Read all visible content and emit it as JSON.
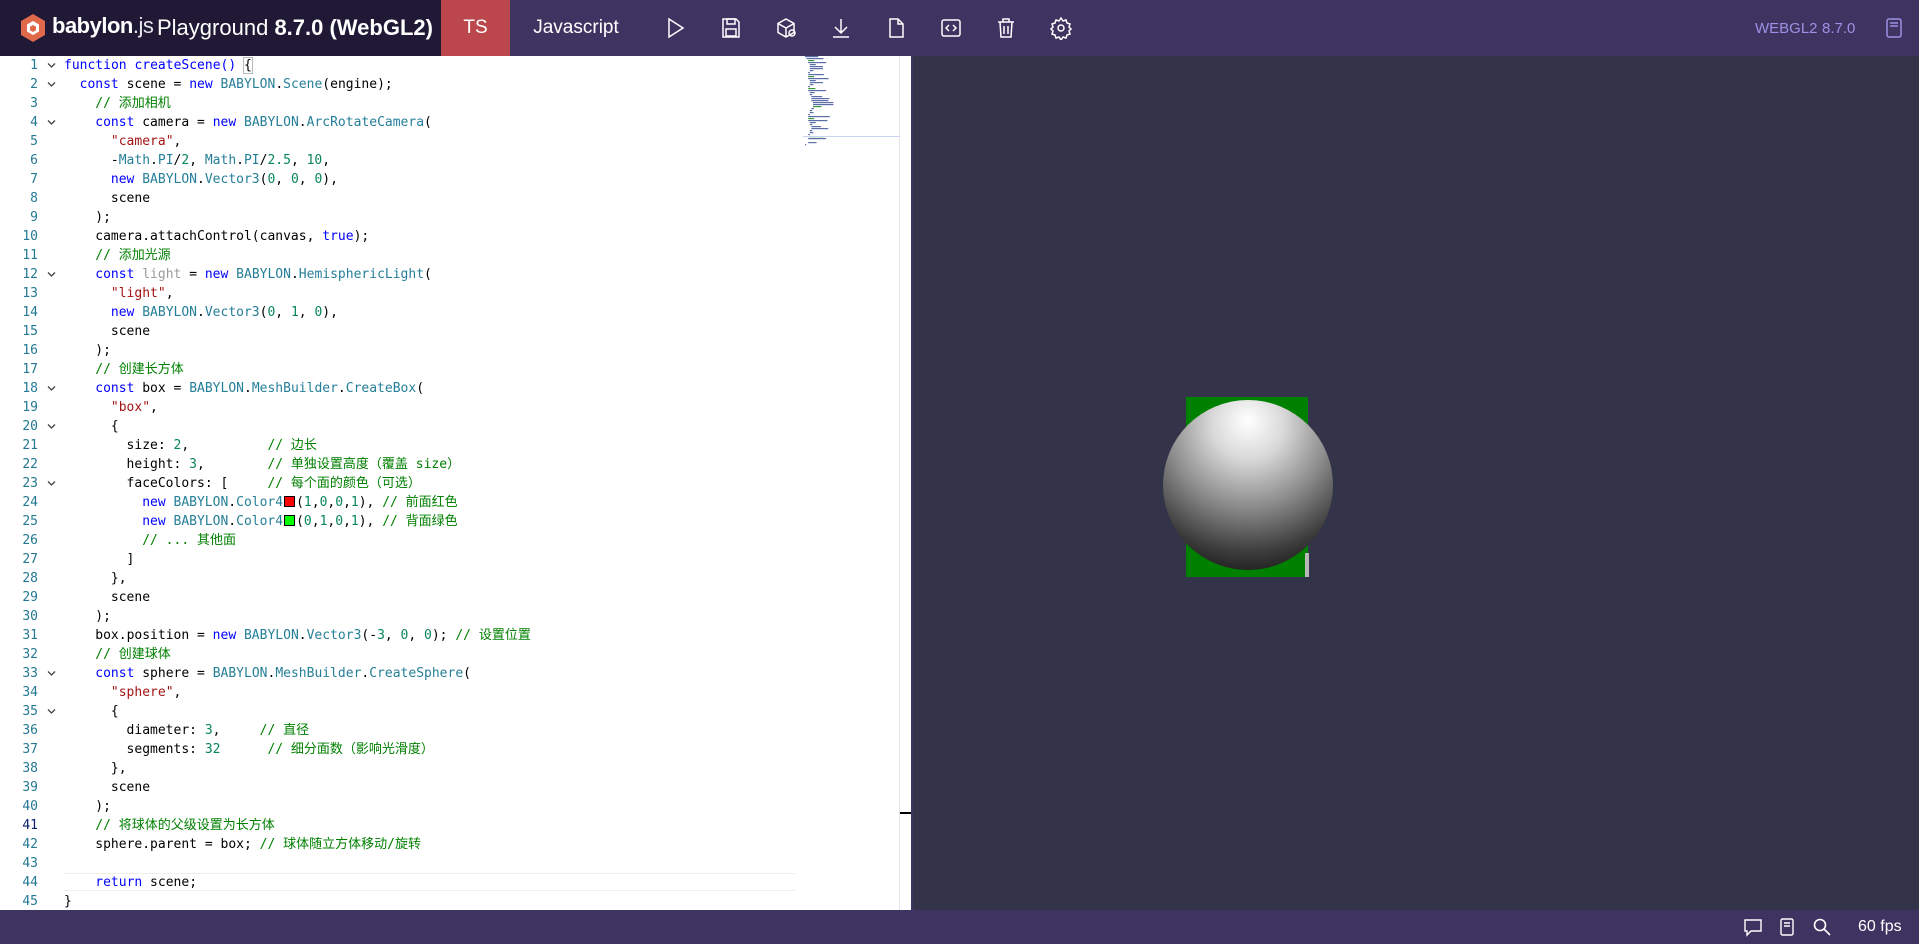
{
  "header": {
    "brand_name": "babylon",
    "brand_ext": ".js",
    "playground_label": "Playground",
    "version_label": "8.7.0 (WebGL2)",
    "lang_ts": "TS",
    "lang_js": "Javascript",
    "toolbar_icons": [
      "run-icon",
      "save-icon",
      "inspector-icon",
      "download-icon",
      "new-icon",
      "clear-icon",
      "delete-icon",
      "settings-icon"
    ],
    "engine_label": "WEBGL2",
    "engine_version": "8.7.0",
    "colors": {
      "header_bg": "#3f3461",
      "brand_bg": "#201936",
      "active_lang": "#bb464b",
      "accent_text": "#9c91e6"
    }
  },
  "editor": {
    "active_line": 41,
    "lines": [
      {
        "n": "1",
        "fold": true
      },
      {
        "n": "2",
        "fold": true
      },
      {
        "n": "3",
        "fold": false
      },
      {
        "n": "4",
        "fold": true
      },
      {
        "n": "5",
        "fold": false
      },
      {
        "n": "6",
        "fold": false
      },
      {
        "n": "7",
        "fold": false
      },
      {
        "n": "8",
        "fold": false
      },
      {
        "n": "9",
        "fold": false
      },
      {
        "n": "10",
        "fold": false
      },
      {
        "n": "11",
        "fold": false
      },
      {
        "n": "12",
        "fold": true
      },
      {
        "n": "13",
        "fold": false
      },
      {
        "n": "14",
        "fold": false
      },
      {
        "n": "15",
        "fold": false
      },
      {
        "n": "16",
        "fold": false
      },
      {
        "n": "17",
        "fold": false
      },
      {
        "n": "18",
        "fold": true
      },
      {
        "n": "19",
        "fold": false
      },
      {
        "n": "20",
        "fold": true
      },
      {
        "n": "21",
        "fold": false
      },
      {
        "n": "22",
        "fold": false
      },
      {
        "n": "23",
        "fold": true
      },
      {
        "n": "24",
        "fold": false
      },
      {
        "n": "25",
        "fold": false
      },
      {
        "n": "26",
        "fold": false
      },
      {
        "n": "27",
        "fold": false
      },
      {
        "n": "28",
        "fold": false
      },
      {
        "n": "29",
        "fold": false
      },
      {
        "n": "30",
        "fold": false
      },
      {
        "n": "31",
        "fold": false
      },
      {
        "n": "32",
        "fold": false
      },
      {
        "n": "33",
        "fold": true
      },
      {
        "n": "34",
        "fold": false
      },
      {
        "n": "35",
        "fold": true
      },
      {
        "n": "36",
        "fold": false
      },
      {
        "n": "37",
        "fold": false
      },
      {
        "n": "38",
        "fold": false
      },
      {
        "n": "39",
        "fold": false
      },
      {
        "n": "40",
        "fold": false
      },
      {
        "n": "41",
        "fold": false
      },
      {
        "n": "42",
        "fold": false
      },
      {
        "n": "43",
        "fold": false
      },
      {
        "n": "44",
        "fold": false
      },
      {
        "n": "45",
        "fold": false
      }
    ],
    "code": {
      "l1": [
        "function createScene() ",
        "{"
      ],
      "l2": [
        "const",
        " scene = ",
        "new",
        " ",
        "BABYLON",
        ".",
        "Scene",
        "(engine);"
      ],
      "l3": "// 添加相机",
      "l4": [
        "const",
        " camera = ",
        "new",
        " ",
        "BABYLON",
        ".",
        "ArcRotateCamera",
        "("
      ],
      "l5": [
        "\"camera\"",
        ","
      ],
      "l6": [
        "-",
        "Math",
        ".",
        "PI",
        "/",
        "2",
        ", ",
        "Math",
        ".",
        "PI",
        "/",
        "2.5",
        ", ",
        "10",
        ","
      ],
      "l7": [
        "new",
        " ",
        "BABYLON",
        ".",
        "Vector3",
        "(",
        "0",
        ", ",
        "0",
        ", ",
        "0",
        "),"
      ],
      "l8": "scene",
      "l9": ");",
      "l10": [
        "camera.attachControl(canvas, ",
        "true",
        ");"
      ],
      "l11": "// 添加光源",
      "l12": [
        "const",
        " ",
        "light",
        " = ",
        "new",
        " ",
        "BABYLON",
        ".",
        "HemisphericLight",
        "("
      ],
      "l13": [
        "\"light\"",
        ","
      ],
      "l14": [
        "new",
        " ",
        "BABYLON",
        ".",
        "Vector3",
        "(",
        "0",
        ", ",
        "1",
        ", ",
        "0",
        "),"
      ],
      "l15": "scene",
      "l16": ");",
      "l17": "// 创建长方体",
      "l18": [
        "const",
        " box = ",
        "BABYLON",
        ".",
        "MeshBuilder",
        ".",
        "CreateBox",
        "("
      ],
      "l19": [
        "\"box\"",
        ","
      ],
      "l20": "{",
      "l21": [
        "size: ",
        "2",
        ",          ",
        "// 边长"
      ],
      "l22": [
        "height: ",
        "3",
        ",        ",
        "// 单独设置高度（覆盖 size）"
      ],
      "l23": [
        "faceColors: [     ",
        "// 每个面的颜色（可选）"
      ],
      "l24": [
        "new",
        " ",
        "BABYLON",
        ".",
        "Color4",
        "(",
        "1",
        ",",
        "0",
        ",",
        "0",
        ",",
        "1",
        "), ",
        "// 前面红色"
      ],
      "l25": [
        "new",
        " ",
        "BABYLON",
        ".",
        "Color4",
        "(",
        "0",
        ",",
        "1",
        ",",
        "0",
        ",",
        "1",
        "), ",
        "// 背面绿色"
      ],
      "l26": "// ... 其他面",
      "l27": "]",
      "l28": "},",
      "l29": "scene",
      "l30": ");",
      "l31": [
        "box.position = ",
        "new",
        " ",
        "BABYLON",
        ".",
        "Vector3",
        "(-",
        "3",
        ", ",
        "0",
        ", ",
        "0",
        "); ",
        "// 设置位置"
      ],
      "l32": "// 创建球体",
      "l33": [
        "const",
        " sphere = ",
        "BABYLON",
        ".",
        "MeshBuilder",
        ".",
        "CreateSphere",
        "("
      ],
      "l34": [
        "\"sphere\"",
        ","
      ],
      "l35": "{",
      "l36": [
        "diameter: ",
        "3",
        ",     ",
        "// 直径"
      ],
      "l37": [
        "segments: ",
        "32",
        "      ",
        "// 细分面数（影响光滑度）"
      ],
      "l38": "},",
      "l39": "scene",
      "l40": ");",
      "l41": "// 将球体的父级设置为长方体",
      "l42": [
        "sphere.parent = box; ",
        "// 球体随立方体移动/旋转"
      ],
      "l43": "",
      "l44": [
        "return",
        " scene;"
      ],
      "l45": "}"
    },
    "swatch_colors": {
      "red": "#ff0000",
      "green": "#00ff00"
    }
  },
  "scene": {
    "background": "#333349",
    "box_color": "#008000"
  },
  "footer": {
    "icons": [
      "comment-icon",
      "book-icon",
      "search-icon"
    ],
    "fps": "60 fps"
  }
}
